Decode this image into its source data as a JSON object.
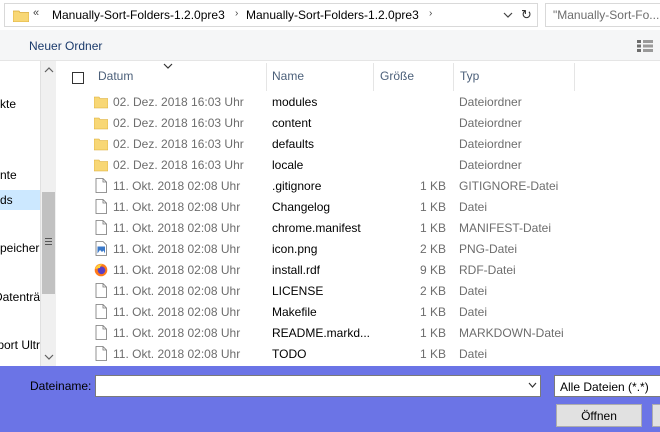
{
  "address": {
    "prefix": "«",
    "crumbs": [
      "Manually-Sort-Folders-1.2.0pre3",
      "Manually-Sort-Folders-1.2.0pre3"
    ],
    "search_placeholder": "\"Manually-Sort-Fo..."
  },
  "toolbar": {
    "new_folder": "Neuer Ordner"
  },
  "nav": {
    "items": [
      {
        "label": "kte",
        "selected": false
      },
      {
        "label": "nte",
        "selected": false
      },
      {
        "label": "ds",
        "selected": true
      },
      {
        "label": "peicher",
        "selected": false
      },
      {
        "label": "Datenträ",
        "selected": false
      },
      {
        "label": "port Ultr",
        "selected": false
      }
    ]
  },
  "columns": {
    "date": "Datum",
    "name": "Name",
    "size": "Größe",
    "type": "Typ"
  },
  "files": [
    {
      "date": "02. Dez. 2018 16:03 Uhr",
      "name": "modules",
      "size": "",
      "type": "Dateiordner",
      "icon": "folder-icon"
    },
    {
      "date": "02. Dez. 2018 16:03 Uhr",
      "name": "content",
      "size": "",
      "type": "Dateiordner",
      "icon": "folder-icon"
    },
    {
      "date": "02. Dez. 2018 16:03 Uhr",
      "name": "defaults",
      "size": "",
      "type": "Dateiordner",
      "icon": "folder-icon"
    },
    {
      "date": "02. Dez. 2018 16:03 Uhr",
      "name": "locale",
      "size": "",
      "type": "Dateiordner",
      "icon": "folder-icon"
    },
    {
      "date": "11. Okt. 2018 02:08 Uhr",
      "name": ".gitignore",
      "size": "1 KB",
      "type": "GITIGNORE-Datei",
      "icon": "file-icon"
    },
    {
      "date": "11. Okt. 2018 02:08 Uhr",
      "name": "Changelog",
      "size": "1 KB",
      "type": "Datei",
      "icon": "file-icon"
    },
    {
      "date": "11. Okt. 2018 02:08 Uhr",
      "name": "chrome.manifest",
      "size": "1 KB",
      "type": "MANIFEST-Datei",
      "icon": "file-icon"
    },
    {
      "date": "11. Okt. 2018 02:08 Uhr",
      "name": "icon.png",
      "size": "2 KB",
      "type": "PNG-Datei",
      "icon": "image-file-icon"
    },
    {
      "date": "11. Okt. 2018 02:08 Uhr",
      "name": "install.rdf",
      "size": "9 KB",
      "type": "RDF-Datei",
      "icon": "firefox-icon"
    },
    {
      "date": "11. Okt. 2018 02:08 Uhr",
      "name": "LICENSE",
      "size": "2 KB",
      "type": "Datei",
      "icon": "file-icon"
    },
    {
      "date": "11. Okt. 2018 02:08 Uhr",
      "name": "Makefile",
      "size": "1 KB",
      "type": "Datei",
      "icon": "file-icon"
    },
    {
      "date": "11. Okt. 2018 02:08 Uhr",
      "name": "README.markd...",
      "size": "1 KB",
      "type": "MARKDOWN-Datei",
      "icon": "file-icon"
    },
    {
      "date": "11. Okt. 2018 02:08 Uhr",
      "name": "TODO",
      "size": "1 KB",
      "type": "Datei",
      "icon": "file-icon"
    }
  ],
  "bottom": {
    "filename_label": "Dateiname:",
    "filename_value": "",
    "filter_value": "Alle Dateien (*.*)",
    "open_label": "Öffnen"
  },
  "colors": {
    "selected_bg": "#cce8ff",
    "bottom_bar": "#6b74e6",
    "folder": "#f8d775"
  }
}
